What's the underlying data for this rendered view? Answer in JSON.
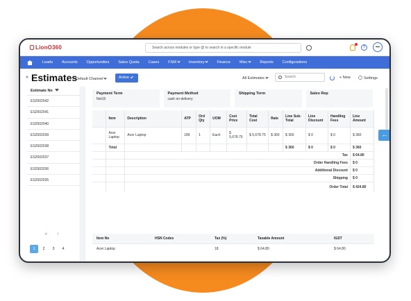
{
  "topbar": {
    "logo": "LionO360",
    "search_placeholder": "Search across modules or type @ to search in a specific module"
  },
  "nav": {
    "items": [
      "Leads",
      "Accounts",
      "Opportunities",
      "Sales Quota",
      "Cases",
      "FSM",
      "Inventory",
      "Finance",
      "Misc",
      "Reports",
      "Configurations"
    ],
    "dropdown_items": [
      "FSM",
      "Inventory",
      "Misc"
    ]
  },
  "toolbar": {
    "title": "Estimates",
    "channel": "Default Channel",
    "status": "Active",
    "view": "All Estimates",
    "search_placeholder": "Search",
    "new_label": "+ New",
    "settings_label": "Settings"
  },
  "sidebar": {
    "header": "Estimate No",
    "items": [
      "ES2502042",
      "ES2502041",
      "ES2502040",
      "ES2502039",
      "ES2502038",
      "ES2502037",
      "ES2502036",
      "ES2502035"
    ],
    "pager_arrows": "« ‹",
    "pages": [
      "1",
      "2",
      "3",
      "4"
    ]
  },
  "info": {
    "payment_term_label": "Payment Term",
    "payment_term_value": "Net15",
    "payment_method_label": "Payment Method",
    "payment_method_value": "cash on delivery",
    "shipping_term_label": "Shipping Term",
    "sales_rep_label": "Sales Rep"
  },
  "lines": {
    "headers": [
      "Item",
      "Description",
      "ATP",
      "Ord Qty",
      "UOM",
      "Cost Price",
      "Total Cost",
      "Rate",
      "Line Sub-Total",
      "Line Discount",
      "Handling Fees",
      "Line Amount"
    ],
    "row": [
      "Acer Laptop",
      "Acer Laptop",
      "189",
      "1",
      "Each",
      "$ 5,678.75",
      "$ 5,678.75",
      "$ 360",
      "$ 360",
      "$ 0",
      "$ 0",
      "$ 360"
    ],
    "total_label": "Total",
    "total_values": [
      "$ 360",
      "$ 0",
      "$ 0",
      "$ 360"
    ],
    "summary": [
      {
        "label": "Tax",
        "value": "$ 64.80"
      },
      {
        "label": "Order Handling Fees",
        "value": "$ 0"
      },
      {
        "label": "Additional Discount",
        "value": "$ 0"
      },
      {
        "label": "Shipping",
        "value": "$ 0"
      },
      {
        "label": "Order Total",
        "value": "$ 424.80"
      }
    ]
  },
  "tax": {
    "headers": [
      "Item No",
      "HSN Codes",
      "Tax (%)",
      "Taxable Amount",
      "IGST"
    ],
    "row": [
      "Acer Laptop",
      "",
      "18",
      "$ 64.80",
      "$ 64.80"
    ]
  },
  "colors": {
    "accent": "#3f6ed8",
    "orange": "#f58a1f"
  }
}
